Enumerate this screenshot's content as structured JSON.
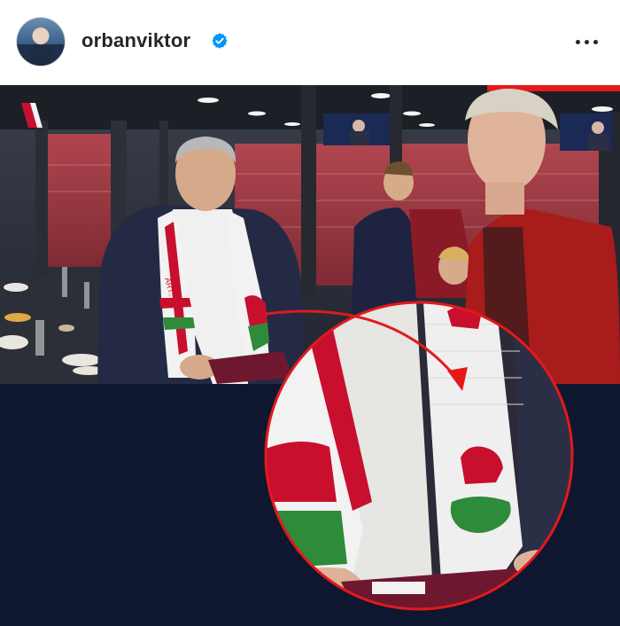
{
  "post": {
    "username": "orbanviktor",
    "verified": true,
    "more_icon": "more-horizontal-icon",
    "avatar_icon": "profile-avatar"
  },
  "colors": {
    "header_bg": "#ffffff",
    "username_text": "#262626",
    "verified_blue": "#0095f6",
    "photo_bottom_bg": "#0f1730",
    "annotation_red": "#e3191c",
    "scarf_red": "#c8102e",
    "scarf_green": "#2e8b3a",
    "scarf_white": "#f2f2f2"
  },
  "photo": {
    "scarf_text": "ÁRT..."
  }
}
